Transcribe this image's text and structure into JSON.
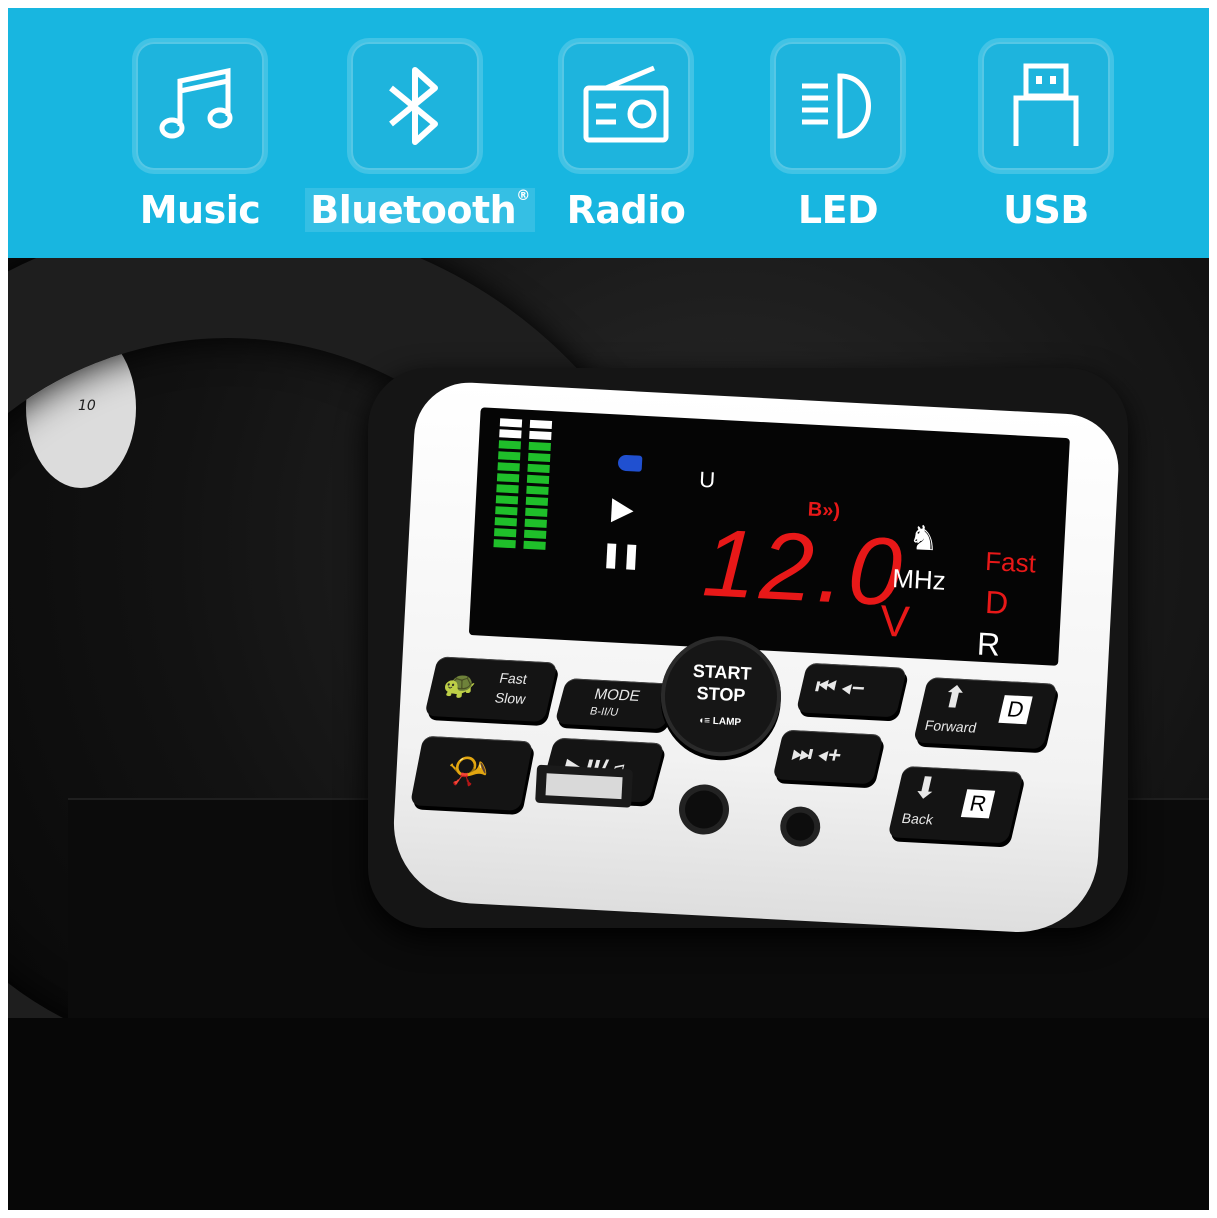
{
  "banner": {
    "features": [
      {
        "label": "Music",
        "icon": "music-note-icon"
      },
      {
        "label": "Bluetooth",
        "mark": "®",
        "icon": "bluetooth-icon"
      },
      {
        "label": "Radio",
        "icon": "radio-icon"
      },
      {
        "label": "LED",
        "icon": "led-headlight-icon"
      },
      {
        "label": "USB",
        "icon": "usb-icon"
      }
    ],
    "background_color": "#18b6e0"
  },
  "display": {
    "indicator_u": "U",
    "bluetooth_indicator": "B",
    "reading": "12.0",
    "unit_v": "V",
    "unit_mhz": "MHz",
    "speed_mode": "Fast",
    "gear_d": "D",
    "gear_r": "R",
    "reading_color": "#e81818"
  },
  "buttons": {
    "speed": {
      "fast": "Fast",
      "slow": "Slow"
    },
    "mode": {
      "label": "MODE",
      "sub": "B-II/U"
    },
    "start_stop": {
      "start": "START",
      "stop": "STOP",
      "lamp": "LAMP"
    },
    "forward": {
      "label": "Forward",
      "letter": "D"
    },
    "back": {
      "label": "Back",
      "letter": "R"
    }
  },
  "dashboard": {
    "gauge_number": "10"
  }
}
